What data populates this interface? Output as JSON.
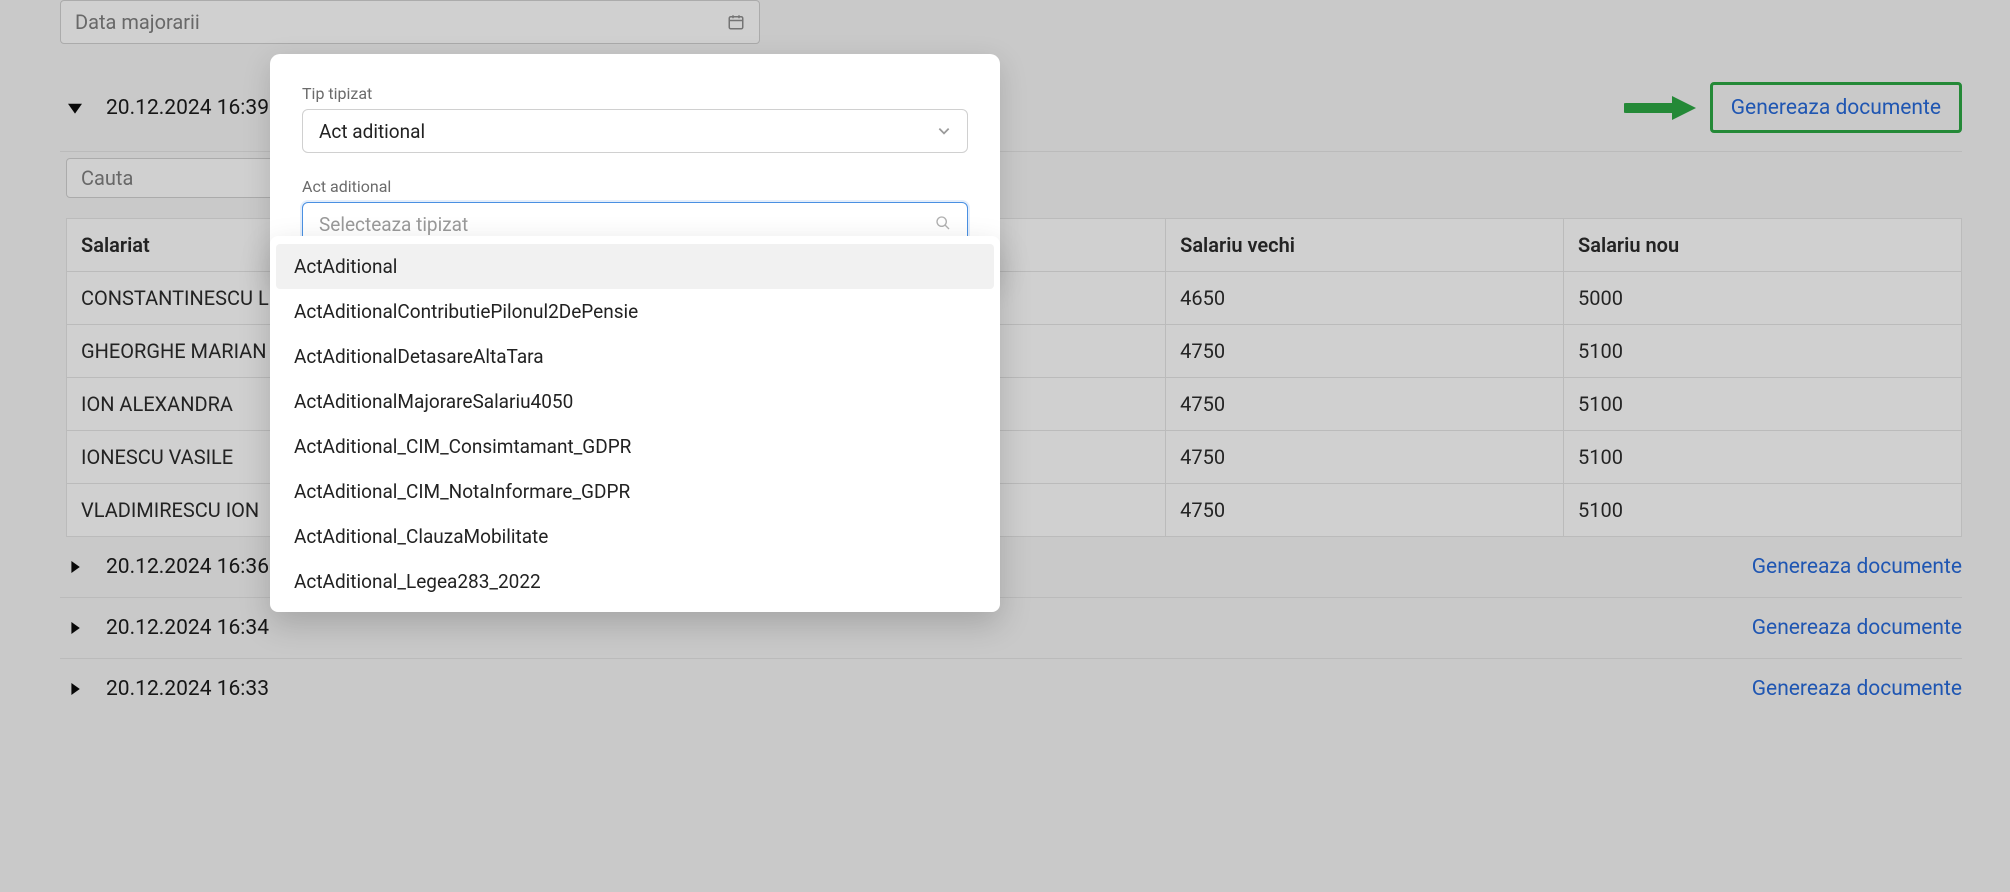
{
  "date_input": {
    "placeholder": "Data majorarii"
  },
  "actions": {
    "generate_label": "Genereaza documente"
  },
  "expanded_section": {
    "timestamp": "20.12.2024 16:39",
    "search_placeholder": "Cauta",
    "columns": {
      "employee": "Salariat",
      "old_salary": "Salariu vechi",
      "new_salary": "Salariu nou"
    },
    "rows": [
      {
        "employee": "CONSTANTINESCU L",
        "old": "4650",
        "new": "5000"
      },
      {
        "employee": "GHEORGHE MARIAN",
        "old": "4750",
        "new": "5100"
      },
      {
        "employee": "ION ALEXANDRA",
        "old": "4750",
        "new": "5100"
      },
      {
        "employee": "IONESCU VASILE",
        "old": "4750",
        "new": "5100"
      },
      {
        "employee": "VLADIMIRESCU ION",
        "old": "4750",
        "new": "5100"
      }
    ]
  },
  "collapsed_sections": [
    {
      "timestamp": "20.12.2024 16:36"
    },
    {
      "timestamp": "20.12.2024 16:34"
    },
    {
      "timestamp": "20.12.2024 16:33"
    }
  ],
  "modal": {
    "label_template_type": "Tip tipizat",
    "template_type_value": "Act aditional",
    "label_act_aditional": "Act aditional",
    "search_placeholder": "Selecteaza tipizat",
    "options": [
      "ActAditional",
      "ActAditionalContributiePilonul2DePensie",
      "ActAditionalDetasareAltaTara",
      "ActAditionalMajorareSalariu4050",
      "ActAditional_CIM_Consimtamant_GDPR",
      "ActAditional_CIM_NotaInformare_GDPR",
      "ActAditional_ClauzaMobilitate",
      "ActAditional_Legea283_2022"
    ]
  }
}
